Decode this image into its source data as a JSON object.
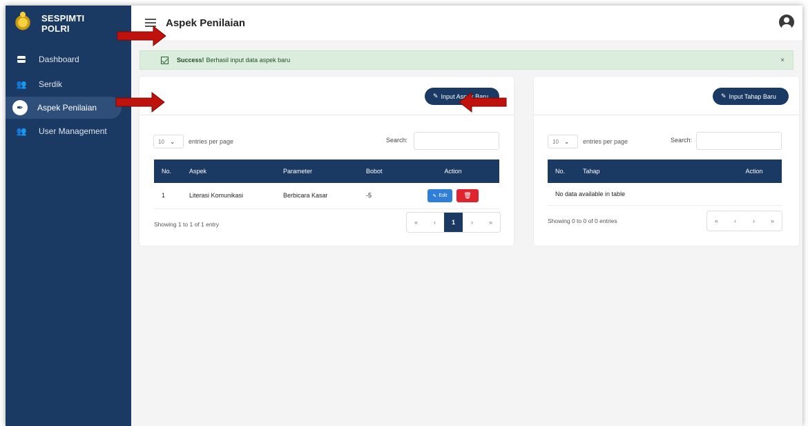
{
  "brand": {
    "line1": "SESPIMTI",
    "line2": "POLRI"
  },
  "sidebar": {
    "items": [
      {
        "label": "Dashboard"
      },
      {
        "label": "Serdik"
      },
      {
        "label": "Aspek Penilaian"
      },
      {
        "label": "User Management"
      }
    ]
  },
  "header": {
    "title": "Aspek Penilaian"
  },
  "alert": {
    "strong": "Success!",
    "message": "Berhasil input data aspek baru",
    "close": "×"
  },
  "aspek_card": {
    "button": "Input Aspek Baru",
    "entries_value": "10",
    "entries_label": "entries per page",
    "search_label": "Search:",
    "columns": [
      "No.",
      "Aspek",
      "Parameter",
      "Bobot",
      "Action"
    ],
    "rows": [
      {
        "no": "1",
        "aspek": "Literasi Komunikasi",
        "parameter": "Berbicara Kasar",
        "bobot": "-5",
        "edit": "Edit"
      }
    ],
    "showing": "Showing 1 to 1 of 1 entry",
    "pager": [
      "«",
      "‹",
      "1",
      "›",
      "»"
    ]
  },
  "tahap_card": {
    "button": "Input Tahap Baru",
    "entries_value": "10",
    "entries_label": "entries per page",
    "search_label": "Search:",
    "columns": [
      "No.",
      "Tahap",
      "Action"
    ],
    "empty": "No data available in table",
    "showing": "Showing 0 to 0 of 0 entries",
    "pager": [
      "«",
      "‹",
      "›",
      "»"
    ]
  },
  "colors": {
    "primary": "#1a3a63",
    "danger": "#e0242e",
    "edit": "#2f7ed8",
    "annotation_arrow": "#c0120c"
  }
}
